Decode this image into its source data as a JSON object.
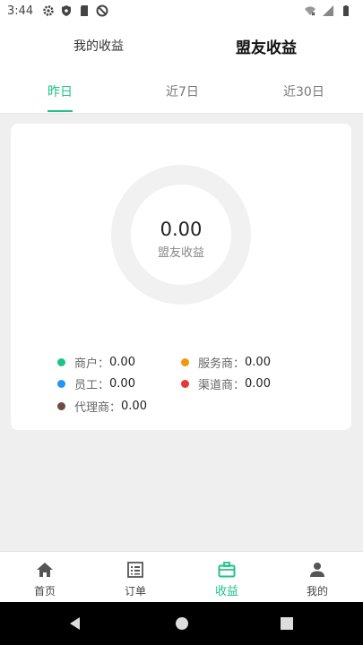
{
  "status_bar": {
    "time": "3:44"
  },
  "header": {
    "tab_left": "我的收益",
    "tab_right": "盟友收益"
  },
  "period_tabs": [
    {
      "label": "昨日",
      "active": true
    },
    {
      "label": "近7日",
      "active": false
    },
    {
      "label": "近30日",
      "active": false
    }
  ],
  "summary": {
    "value": "0.00",
    "label": "盟友收益"
  },
  "legend": [
    {
      "label": "商户：",
      "value": "0.00",
      "color": "#20c286"
    },
    {
      "label": "服务商：",
      "value": "0.00",
      "color": "#f0960f"
    },
    {
      "label": "员工：",
      "value": "0.00",
      "color": "#2196f3"
    },
    {
      "label": "渠道商：",
      "value": "0.00",
      "color": "#e53935"
    },
    {
      "label": "代理商：",
      "value": "0.00",
      "color": "#6d4c41"
    }
  ],
  "bottom_nav": [
    {
      "label": "首页",
      "icon": "home-icon",
      "active": false
    },
    {
      "label": "订单",
      "icon": "order-list-icon",
      "active": false
    },
    {
      "label": "收益",
      "icon": "briefcase-icon",
      "active": true
    },
    {
      "label": "我的",
      "icon": "person-icon",
      "active": false
    }
  ],
  "colors": {
    "accent": "#20c286",
    "background": "#efefef"
  }
}
